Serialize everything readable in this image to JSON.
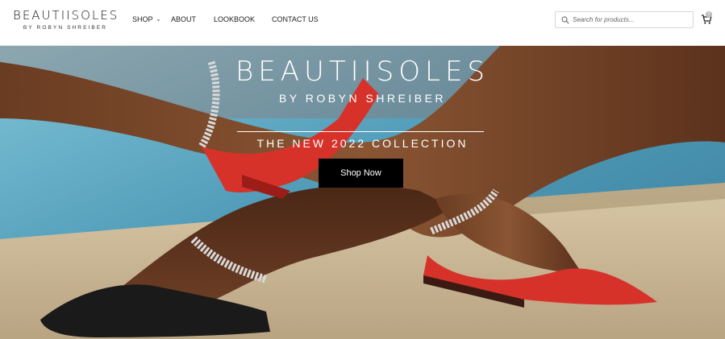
{
  "brand": {
    "name": "BEAUTIISOLES",
    "tagline": "BY ROBYN SHREIBER"
  },
  "nav": {
    "shop": "SHOP",
    "about": "ABOUT",
    "lookbook": "LOOKBOOK",
    "contact": "CONTACT US"
  },
  "search": {
    "placeholder": "Search for products..."
  },
  "cart": {
    "count": "0",
    "icon": "cart-icon"
  },
  "hero": {
    "title": "BEAUTIISOLES",
    "subtitle": "BY ROBYN SHREIBER",
    "collection": "THE NEW 2022 COLLECTION",
    "cta": "Shop Now"
  },
  "colors": {
    "accent": "#000000",
    "shoe_red": "#d6322a",
    "pool": "#5ea9c4",
    "stone": "#c9b89a"
  }
}
